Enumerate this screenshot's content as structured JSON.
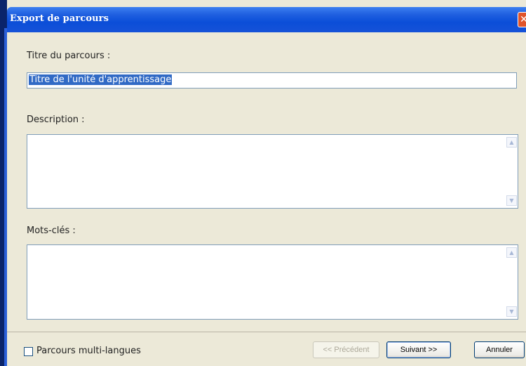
{
  "window": {
    "title": "Export de parcours",
    "close_glyph": "✕"
  },
  "form": {
    "title_label": "Titre du parcours :",
    "title_value": "Titre de l'unité d'apprentissage",
    "description_label": "Description :",
    "description_value": "",
    "keywords_label": "Mots-clés :",
    "keywords_value": ""
  },
  "footer": {
    "multilang_label": "Parcours multi-langues",
    "multilang_checked": false,
    "prev_label": "<< Précédent",
    "next_label": "Suivant >>",
    "cancel_label": "Annuler"
  },
  "icons": {
    "scroll_up": "scroll-up-icon",
    "scroll_down": "scroll-down-icon",
    "close": "close-icon"
  },
  "colors": {
    "titlebar": "#0b4ed8",
    "selection": "#316ac5",
    "close": "#e0552b"
  }
}
